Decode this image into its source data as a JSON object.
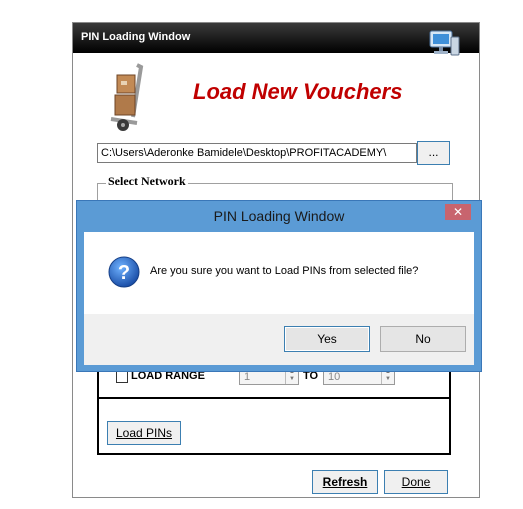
{
  "main_window": {
    "title": "PIN Loading Window",
    "heading": "Load New Vouchers",
    "file_path": "C:\\Users\\Aderonke Bamidele\\Desktop\\PROFITACADEMY\\",
    "browse_label": "...",
    "network_group_label": "Select Network",
    "range": {
      "checkbox_label": "LOAD RANGE",
      "start_value": "1",
      "to_label": "TO",
      "end_value": "10"
    },
    "load_pins_label": "Load PINs",
    "refresh_label": "Refresh",
    "done_label": "Done"
  },
  "dialog": {
    "title": "PIN Loading Window",
    "close_glyph": "✕",
    "message": "Are you sure you want to Load PINs from selected file?",
    "yes_label": "Yes",
    "no_label": "No"
  },
  "colors": {
    "heading": "#c00000",
    "dialog_frame": "#5b9bd5",
    "close_button": "#c8646e"
  },
  "icons": [
    "computer-icon",
    "hand-truck-boxes-icon",
    "question-icon"
  ]
}
